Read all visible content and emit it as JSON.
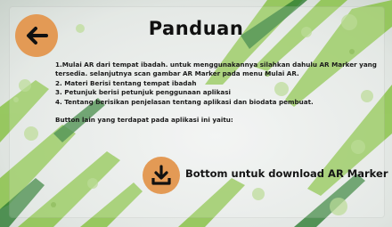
{
  "header": {
    "title": "Panduan",
    "back_icon": "arrow-left-icon"
  },
  "content": {
    "item1": "1.Mulai AR dari tempat ibadah. untuk menggunakannya silahkan dahulu AR Marker yang tersedia. selanjutnya scan gambar AR Marker pada menu Mulai AR.",
    "item2": "2. Materi Berisi tentang tempat ibadah",
    "item3": "3. Petunjuk berisi petunjuk penggunaan aplikasi",
    "item4": "4. Tentang berisikan penjelasan tentang aplikasi dan biodata pembuat.",
    "buttons_intro": "Button lain yang terdapat pada aplikasi ini yaitu:"
  },
  "download": {
    "icon": "download-icon",
    "label": "Bottom untuk download AR Marker"
  },
  "colors": {
    "accent": "#e39a55",
    "leaf_green": "#7cb342",
    "leaf_dark": "#2e7d32"
  }
}
